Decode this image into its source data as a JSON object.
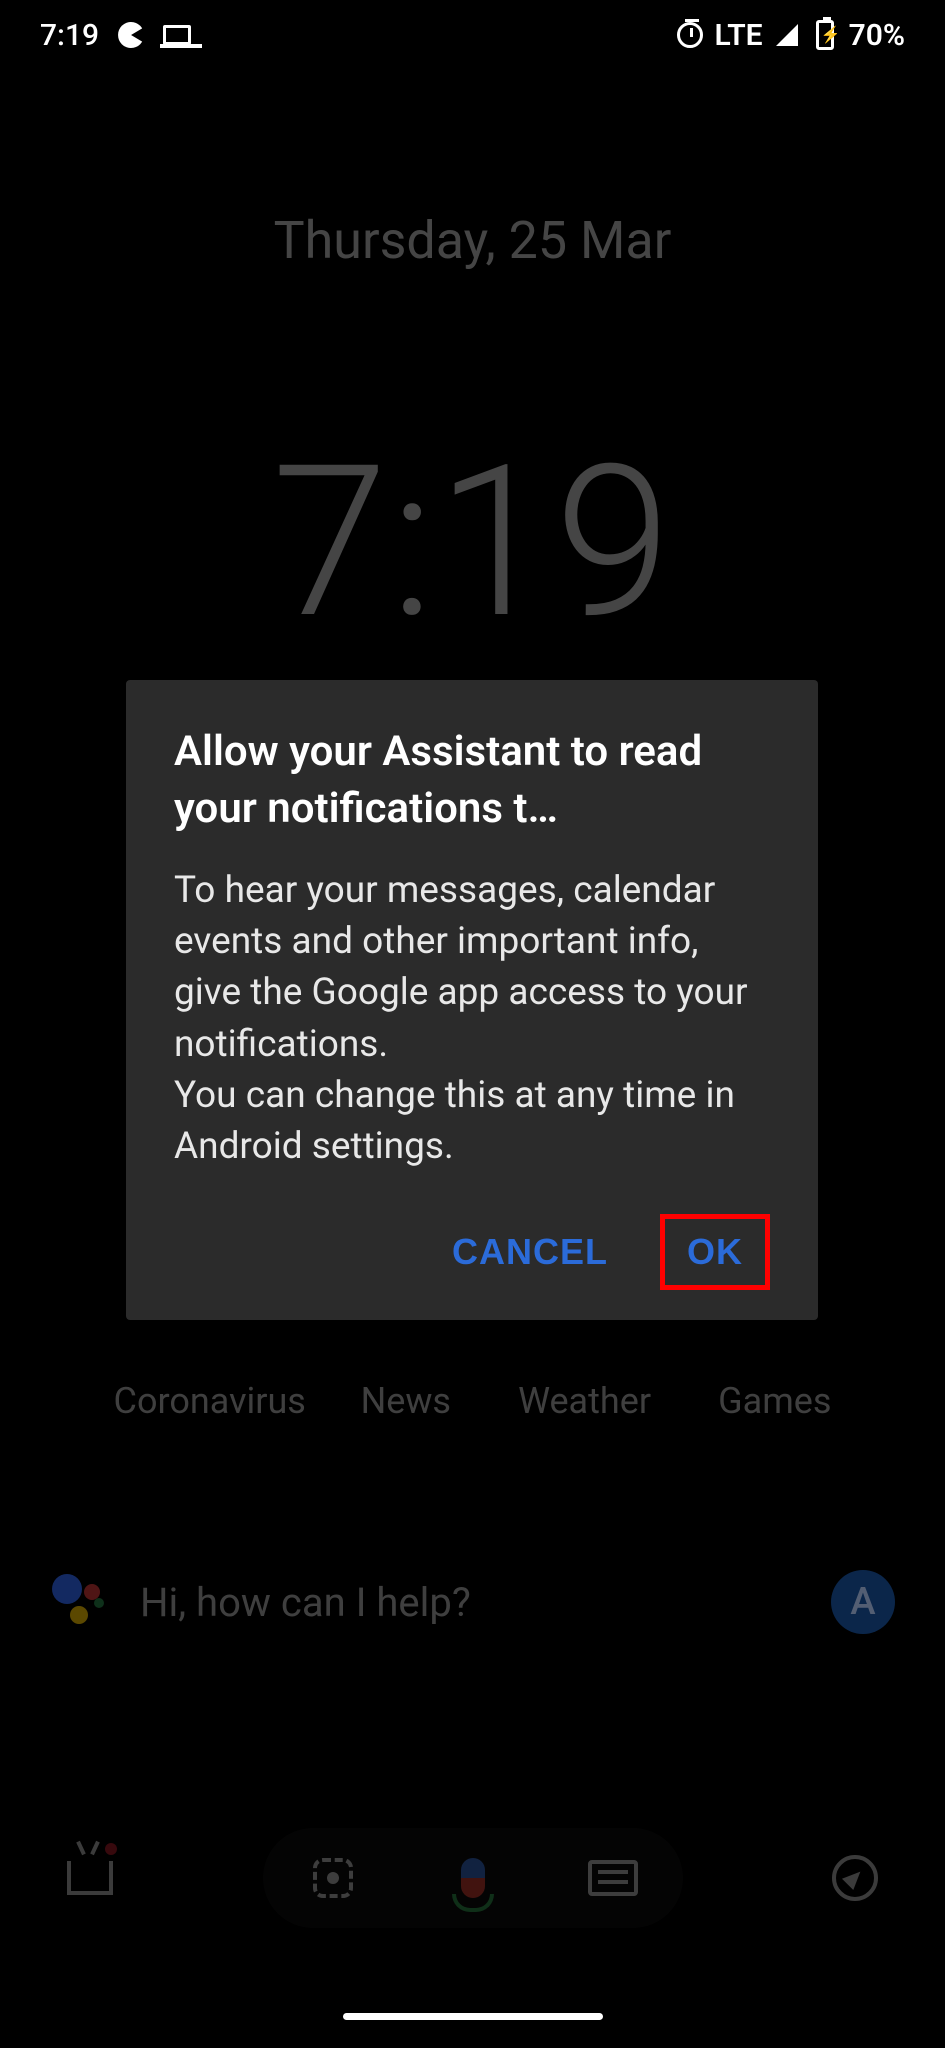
{
  "statusbar": {
    "time": "7:19",
    "network_label": "LTE",
    "battery_text": "70%"
  },
  "home": {
    "date": "Thursday, 25 Mar",
    "clock": "7:19",
    "chips": [
      "Coronavirus",
      "News",
      "Weather",
      "Games"
    ]
  },
  "assistant": {
    "prompt": "Hi, how can I help?",
    "avatar_initial": "A"
  },
  "dialog": {
    "title": "Allow your Assistant to read your notifications t…",
    "body": "To hear your messages, calendar events and other important info, give the Google app access to your notifications.\nYou can change this at any time in Android settings.",
    "cancel_label": "CANCEL",
    "ok_label": "OK"
  },
  "annotation": {
    "highlight_target": "ok-button"
  }
}
